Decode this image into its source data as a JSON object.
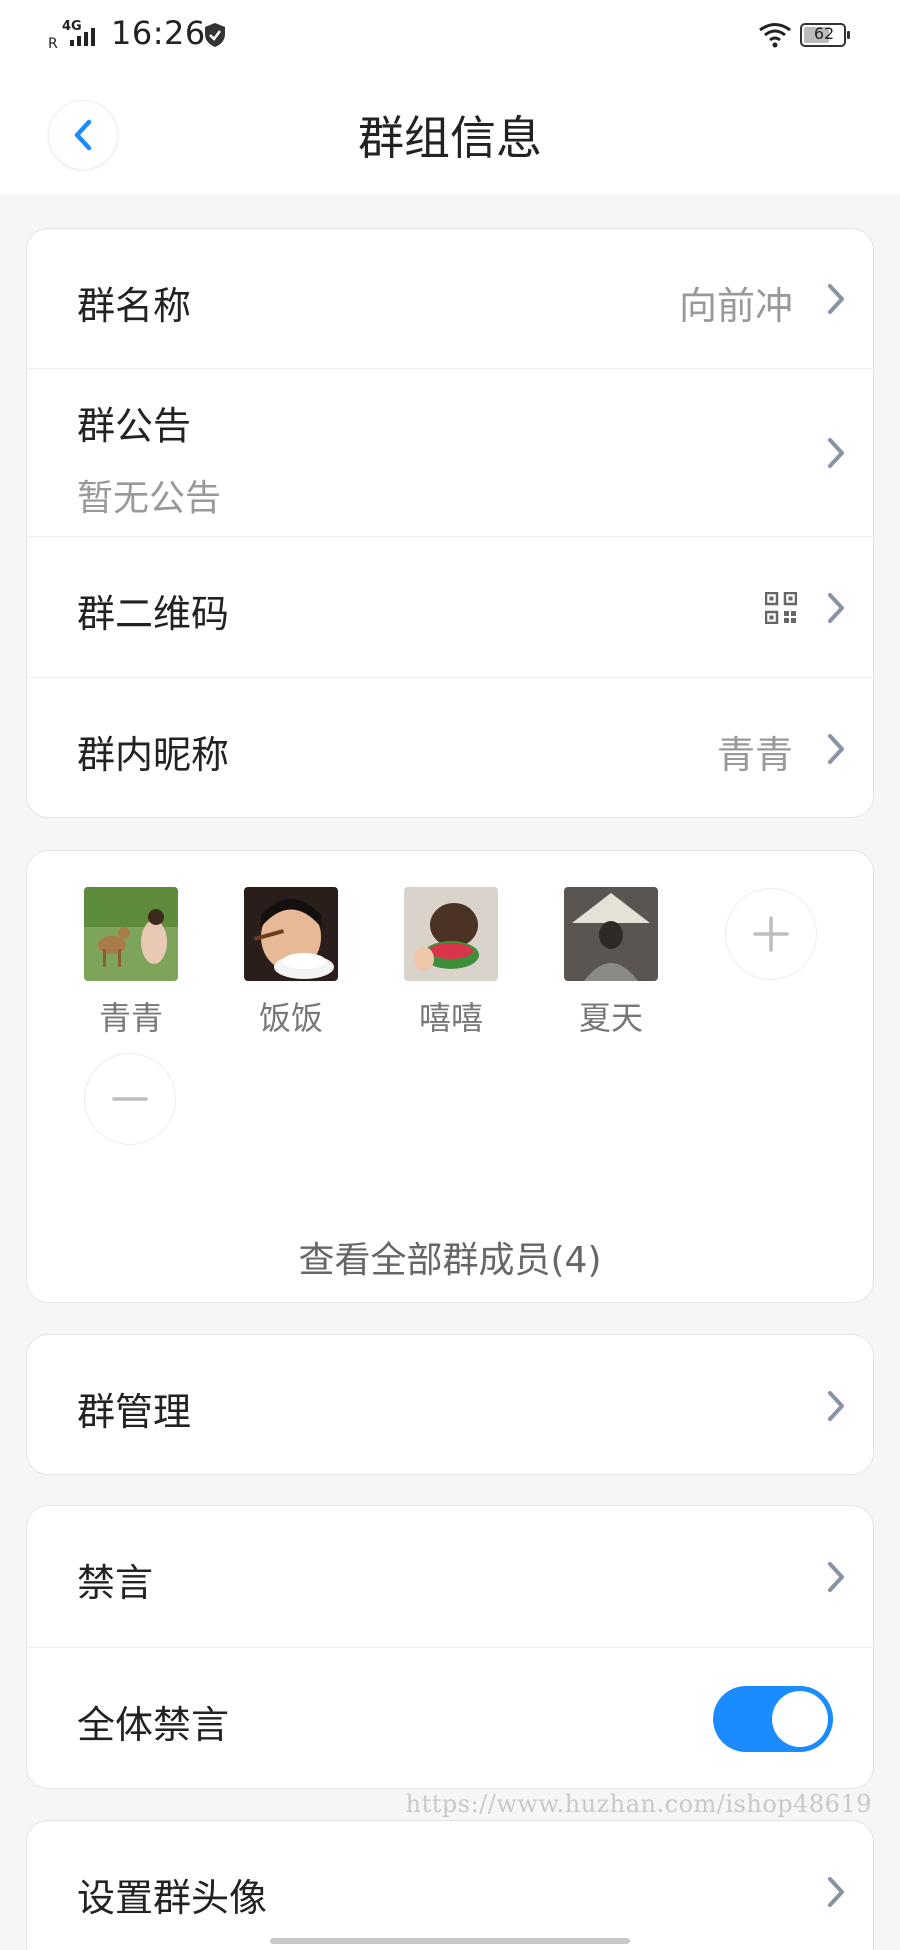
{
  "status_bar": {
    "time": "16:26",
    "network": "4G",
    "roaming": "R",
    "battery": "62"
  },
  "header": {
    "title": "群组信息",
    "back_icon": "chevron-left-icon"
  },
  "group_info": {
    "name_label": "群名称",
    "name_value": "向前冲",
    "notice_label": "群公告",
    "notice_value": "暂无公告",
    "qrcode_label": "群二维码",
    "qrcode_icon": "qr-code-icon",
    "nickname_label": "群内昵称",
    "nickname_value": "青青"
  },
  "members": {
    "items": [
      {
        "name": "青青"
      },
      {
        "name": "饭饭"
      },
      {
        "name": "嘻嘻"
      },
      {
        "name": "夏天"
      }
    ],
    "add_icon": "plus-icon",
    "remove_icon": "minus-icon",
    "view_all": "查看全部群成员(4)"
  },
  "management": {
    "label": "群管理"
  },
  "mute": {
    "mute_label": "禁言",
    "mute_all_label": "全体禁言",
    "mute_all_on": true,
    "toggle_color": "#1a8cff"
  },
  "avatar_setting": {
    "label": "设置群头像"
  },
  "watermark": "https://www.huzhan.com/ishop48619"
}
